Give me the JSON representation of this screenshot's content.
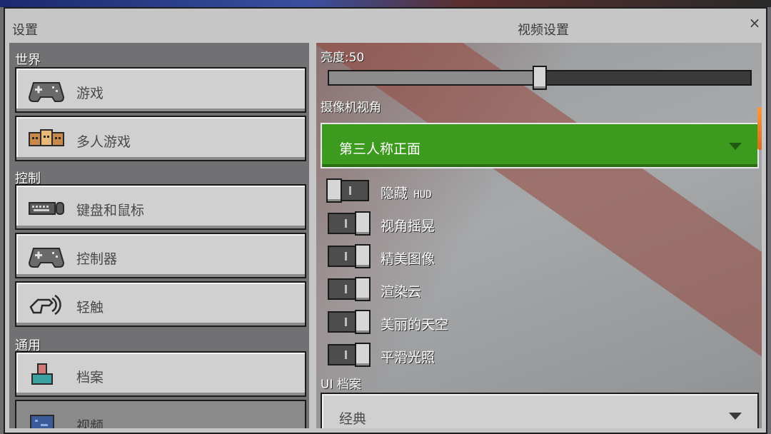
{
  "window": {
    "title_left": "设置",
    "title_center": "视频设置",
    "close_glyph": "×"
  },
  "sidebar": {
    "sections": [
      {
        "label": "世界"
      },
      {
        "label": "控制"
      },
      {
        "label": "通用"
      }
    ],
    "items": [
      {
        "label": "游戏",
        "icon": "gamepad-icon"
      },
      {
        "label": "多人游戏",
        "icon": "players-icon"
      },
      {
        "label": "键盘和鼠标",
        "icon": "keyboard-mouse-icon"
      },
      {
        "label": "控制器",
        "icon": "controller-icon"
      },
      {
        "label": "轻触",
        "icon": "touch-icon"
      },
      {
        "label": "档案",
        "icon": "profile-icon"
      },
      {
        "label": "视频",
        "icon": "video-icon"
      }
    ]
  },
  "video": {
    "brightness_label": "亮度:50",
    "brightness_value": 50,
    "camera_label": "摄像机视角",
    "camera_value": "第三人称正面",
    "toggles": [
      {
        "label": "隐藏",
        "suffix": " HUD",
        "on": false
      },
      {
        "label": "视角摇晃",
        "suffix": "",
        "on": true
      },
      {
        "label": "精美图像",
        "suffix": "",
        "on": true
      },
      {
        "label": "渲染云",
        "suffix": "",
        "on": true
      },
      {
        "label": "美丽的天空",
        "suffix": "",
        "on": true
      },
      {
        "label": "平滑光照",
        "suffix": "",
        "on": true
      }
    ],
    "ui_profile_label": "UI 档案",
    "ui_profile_value": "经典"
  },
  "colors": {
    "accent_green": "#3c9b1f",
    "window_bg": "#c6c6c6",
    "button_bg": "#d0d0d0"
  }
}
